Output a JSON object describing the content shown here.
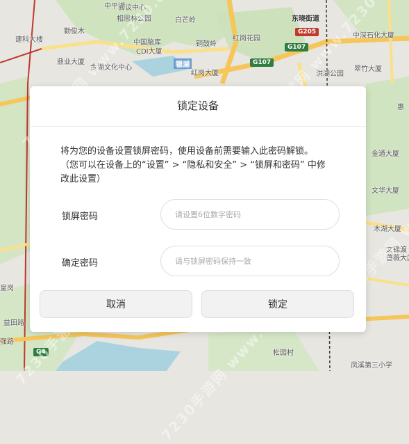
{
  "map": {
    "labels": [
      {
        "id": "pinghu",
        "text": "中平湖"
      },
      {
        "id": "chaguo",
        "text": "会议中心"
      },
      {
        "id": "xiangsilin",
        "text": "相思林公园"
      },
      {
        "id": "baiyunling",
        "text": "白芒岭"
      },
      {
        "id": "dongxiao",
        "text": "东晓街道"
      },
      {
        "id": "jianke",
        "text": "建科大楼"
      },
      {
        "id": "qinjunmu",
        "text": "勤俊木"
      },
      {
        "id": "zhongguonaoku",
        "text": "中国脑库"
      },
      {
        "id": "cdi",
        "text": "CDI大厦"
      },
      {
        "id": "tongguxian",
        "text": "铜鼓岭"
      },
      {
        "id": "honggangyuan",
        "text": "红岗花园"
      },
      {
        "id": "zhongshenshihua",
        "text": "中深石化大厦"
      },
      {
        "id": "jinhuwenhua",
        "text": "金湖文化中心"
      },
      {
        "id": "yinhu",
        "text": "银湖"
      },
      {
        "id": "honggangdasha",
        "text": "红岗大厦"
      },
      {
        "id": "honghugongyuan",
        "text": "洪湖公园"
      },
      {
        "id": "cuizhu",
        "text": "翠竹大厦"
      },
      {
        "id": "dingye",
        "text": "鼎业大厦"
      },
      {
        "id": "jintongdasha",
        "text": "金通大厦"
      },
      {
        "id": "wenhuadasha",
        "text": "文华大厦"
      },
      {
        "id": "mudedasha",
        "text": "木湖大厦"
      },
      {
        "id": "wenjinjiayuan",
        "text": "文锦渡"
      },
      {
        "id": "xiaomeijing",
        "text": "蔷薇大厦"
      },
      {
        "id": "yitianlu",
        "text": "益田路"
      },
      {
        "id": "songyuancun",
        "text": "松园村"
      },
      {
        "id": "fengxi",
        "text": "凤溪第三小学"
      },
      {
        "id": "gaobusheng",
        "text": "皇岗"
      },
      {
        "id": "qianglu",
        "text": "强路"
      },
      {
        "id": "hui",
        "text": "惠"
      }
    ],
    "roads": {
      "g205": "G205",
      "g107a": "G107",
      "g107b": "G107",
      "g4": "G4"
    },
    "watermark": "7230手游网 www.7230.com"
  },
  "dialog": {
    "title": "锁定设备",
    "description_line1": "将为您的设备设置锁屏密码，使用设备前需要输入此密码解锁。",
    "description_line2": "（您可以在设备上的“设置” > “隐私和安全” > “锁屏和密码” 中修",
    "description_line3": "改此设置）",
    "password": {
      "label": "锁屏密码",
      "placeholder": "请设置6位数字密码",
      "value": ""
    },
    "confirm": {
      "label": "确定密码",
      "placeholder": "请与锁屏密码保持一致",
      "value": ""
    },
    "cancel_label": "取消",
    "lock_label": "锁定"
  }
}
